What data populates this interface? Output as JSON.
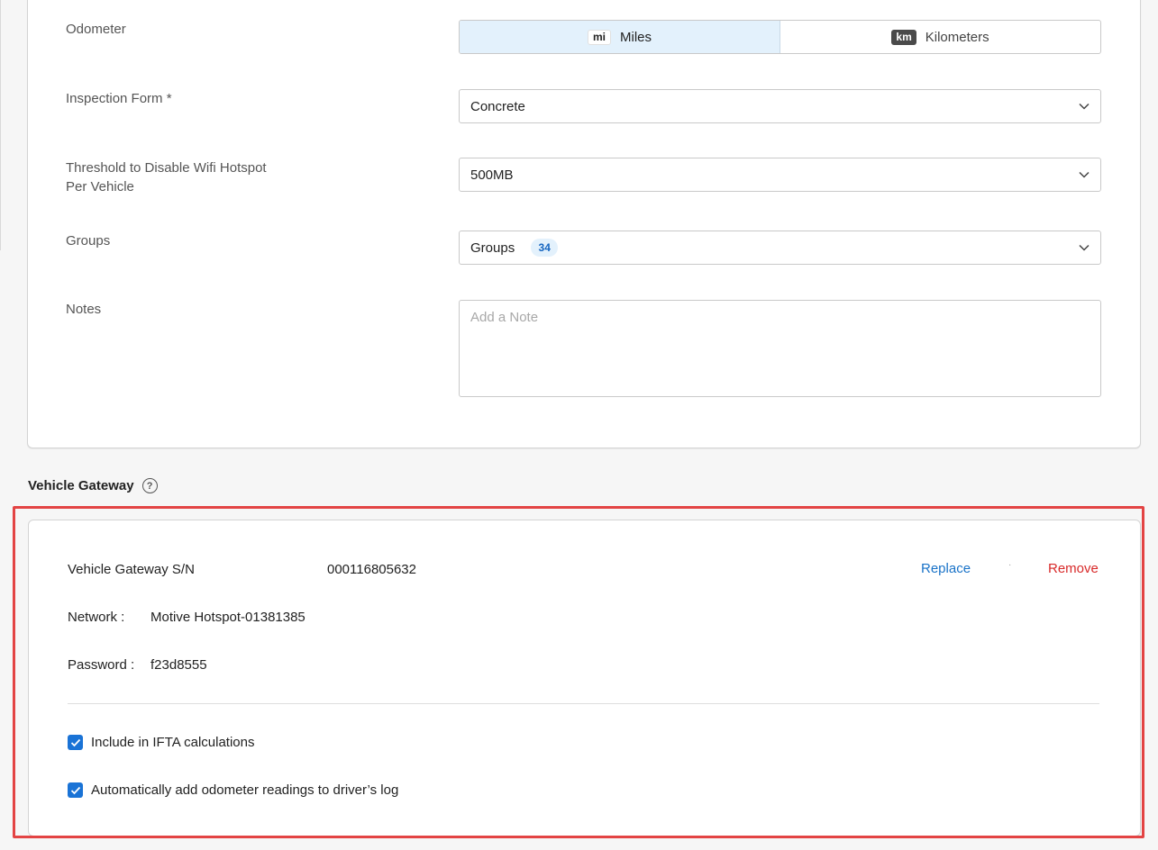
{
  "form": {
    "odometer": {
      "label": "Odometer",
      "options": [
        {
          "badge": "mi",
          "label": "Miles",
          "selected": true
        },
        {
          "badge": "km",
          "label": "Kilometers",
          "selected": false
        }
      ]
    },
    "inspection_form": {
      "label": "Inspection Form *",
      "value": "Concrete"
    },
    "wifi_threshold": {
      "label_line1": "Threshold to Disable Wifi Hotspot",
      "label_line2": "Per Vehicle",
      "value": "500MB"
    },
    "groups": {
      "label": "Groups",
      "value": "Groups",
      "count": "34"
    },
    "notes": {
      "label": "Notes",
      "placeholder": "Add a Note",
      "value": ""
    }
  },
  "vehicle_gateway": {
    "title": "Vehicle Gateway",
    "help_icon": "question-circle-icon",
    "serial_label": "Vehicle Gateway S/N",
    "serial_value": "000116805632",
    "replace_label": "Replace",
    "separator": "·",
    "remove_label": "Remove",
    "network_label": "Network :",
    "network_value": "Motive Hotspot-01381385",
    "password_label": "Password :",
    "password_value": "f23d8555",
    "checkboxes": [
      {
        "label": "Include in IFTA calculations",
        "checked": true
      },
      {
        "label": "Automatically add odometer readings to driver’s log",
        "checked": true
      }
    ]
  },
  "colors": {
    "accent": "#1a73d6",
    "link": "#1a73c8",
    "danger": "#d82a2a",
    "highlight_border": "#e34444",
    "selected_toggle_bg": "#e3f1fc"
  }
}
